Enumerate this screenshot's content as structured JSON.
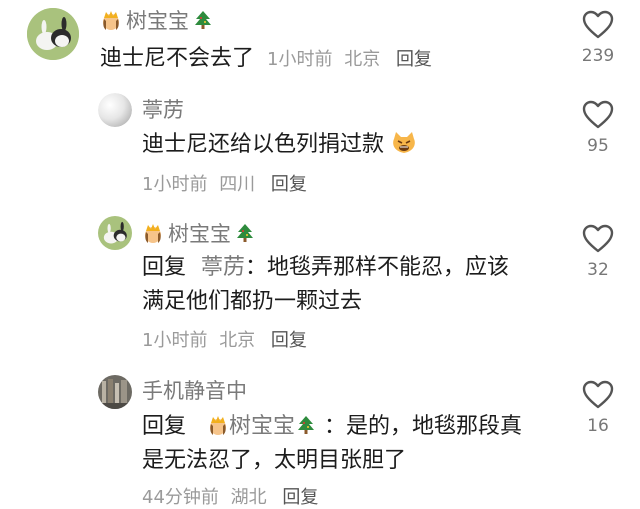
{
  "comments": [
    {
      "username": "树宝宝",
      "text": "迪士尼不会去了",
      "time": "1小时前",
      "location": "北京",
      "reply_label": "回复",
      "likes": "239"
    },
    {
      "username": "葶苈",
      "text": "迪士尼还给以色列捐过款",
      "time": "1小时前",
      "location": "四川",
      "reply_label": "回复",
      "likes": "95"
    },
    {
      "username": "树宝宝",
      "reply_prefix": "回复",
      "mention": "葶苈",
      "text_line1": "：地毯弄那样不能忍，应该",
      "text_line2": "满足他们都扔一颗过去",
      "time": "1小时前",
      "location": "北京",
      "reply_label": "回复",
      "likes": "32"
    },
    {
      "username": "手机静音中",
      "reply_prefix": "回复",
      "mention": "树宝宝",
      "text_line1": "：是的，地毯那段真",
      "text_line2": "是无法忍了，太明目张胆了",
      "time": "44分钟前",
      "location": "湖北",
      "reply_label": "回复",
      "likes": "16"
    }
  ],
  "icons": {
    "like": "heart-outline-icon",
    "badge_crown": "princess-icon",
    "badge_tree": "christmas-tree-icon",
    "emoji": "angry-cat-emoji"
  }
}
